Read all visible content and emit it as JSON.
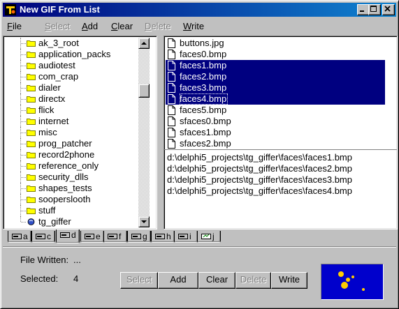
{
  "window": {
    "title": "New GIF From List"
  },
  "menu": [
    {
      "label": "File",
      "u": "F",
      "rest": "ile",
      "disabled": false
    },
    {
      "label": "Select",
      "u": "S",
      "rest": "elect",
      "disabled": true
    },
    {
      "label": "Add",
      "u": "A",
      "rest": "dd",
      "disabled": false
    },
    {
      "label": "Clear",
      "u": "C",
      "rest": "lear",
      "disabled": false
    },
    {
      "label": "Delete",
      "u": "D",
      "rest": "elete",
      "disabled": true
    },
    {
      "label": "Write",
      "u": "W",
      "rest": "rite",
      "disabled": false
    }
  ],
  "folders": [
    "ak_3_root",
    "application_packs",
    "audiotest",
    "com_crap",
    "dialer",
    "directx",
    "flick",
    "internet",
    "misc",
    "prog_patcher",
    "record2phone",
    "reference_only",
    "security_dlls",
    "shapes_tests",
    "sooperslooth",
    "stuff",
    "tg_giffer"
  ],
  "files": [
    {
      "name": "buttons.jpg",
      "selected": false
    },
    {
      "name": "faces0.bmp",
      "selected": false
    },
    {
      "name": "faces1.bmp",
      "selected": true
    },
    {
      "name": "faces2.bmp",
      "selected": true
    },
    {
      "name": "faces3.bmp",
      "selected": true
    },
    {
      "name": "faces4.bmp",
      "selected": true,
      "focused": true
    },
    {
      "name": "faces5.bmp",
      "selected": false
    },
    {
      "name": "sfaces0.bmp",
      "selected": false
    },
    {
      "name": "sfaces1.bmp",
      "selected": false
    },
    {
      "name": "sfaces2.bmp",
      "selected": false
    }
  ],
  "paths": [
    "d:\\delphi5_projects\\tg_giffer\\faces\\faces1.bmp",
    "d:\\delphi5_projects\\tg_giffer\\faces\\faces2.bmp",
    "d:\\delphi5_projects\\tg_giffer\\faces\\faces3.bmp",
    "d:\\delphi5_projects\\tg_giffer\\faces\\faces4.bmp"
  ],
  "drives": [
    {
      "letter": "a",
      "active": false
    },
    {
      "letter": "c",
      "active": false
    },
    {
      "letter": "d",
      "active": true
    },
    {
      "letter": "e",
      "active": false
    },
    {
      "letter": "f",
      "active": false
    },
    {
      "letter": "g",
      "active": false
    },
    {
      "letter": "h",
      "active": false
    },
    {
      "letter": "i",
      "active": false
    },
    {
      "letter": "j",
      "active": false
    }
  ],
  "status": {
    "file_written_label": "File Written:",
    "file_written_value": "...",
    "selected_label": "Selected:",
    "selected_value": "4"
  },
  "buttons": [
    {
      "label": "Select",
      "disabled": true
    },
    {
      "label": "Add",
      "disabled": false
    },
    {
      "label": "Clear",
      "disabled": false
    },
    {
      "label": "Delete",
      "disabled": true
    },
    {
      "label": "Write",
      "disabled": false
    }
  ],
  "colors": {
    "title_start": "#00007c",
    "title_end": "#1084d0",
    "selection": "#000080",
    "preview_bg": "#0000cc",
    "folder": "#ffff00"
  },
  "icons": {
    "app": "app-icon",
    "folder": "folder-icon",
    "open_folder": "open-folder-icon",
    "file": "file-icon",
    "drive": "drive-icon"
  }
}
